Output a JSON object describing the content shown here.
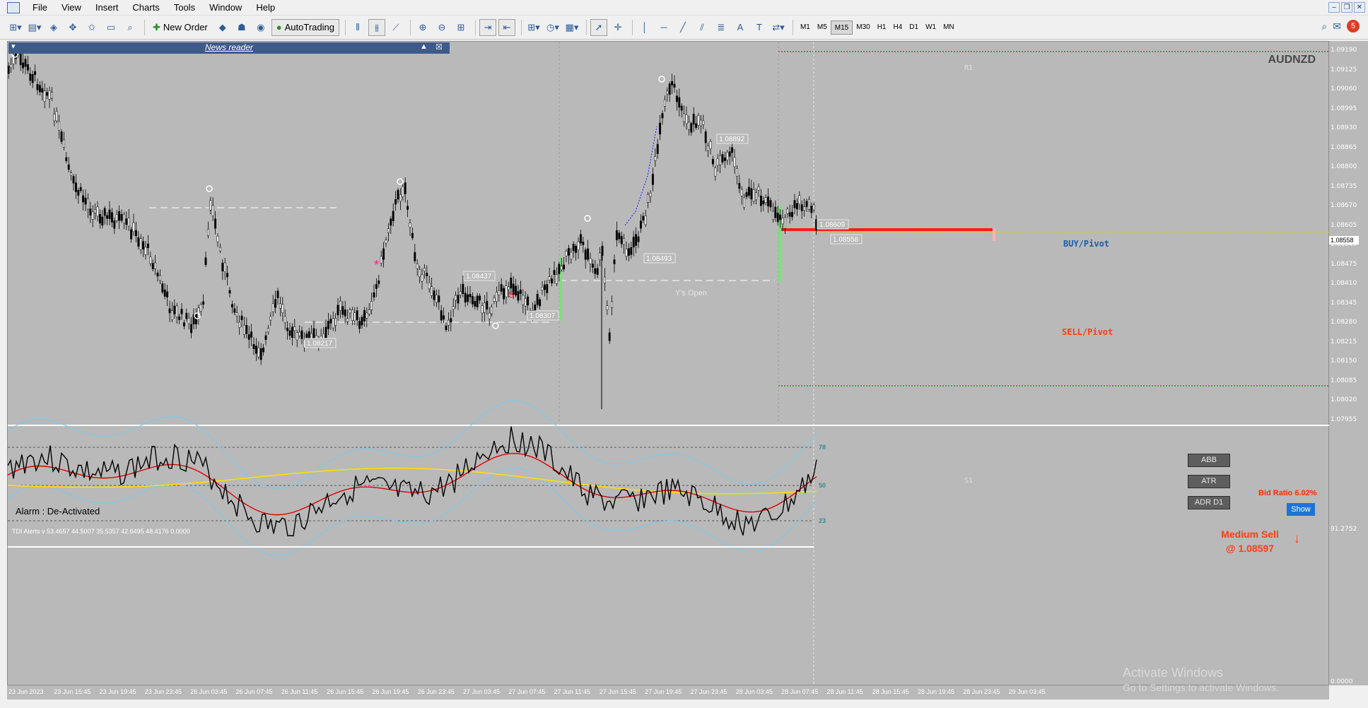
{
  "menu": {
    "items": [
      "File",
      "View",
      "Insert",
      "Charts",
      "Tools",
      "Window",
      "Help"
    ]
  },
  "toolbar": {
    "new_order": "New Order",
    "autotrading": "AutoTrading",
    "timeframes": [
      "M1",
      "M5",
      "M15",
      "M30",
      "H1",
      "H4",
      "D1",
      "W1",
      "MN"
    ],
    "active_timeframe": "M15",
    "notifications": "5"
  },
  "news": {
    "title": "News reader"
  },
  "chart": {
    "symbol": "AUDNZD",
    "alarm": "Alarm : De-Activated",
    "buy_label": "BUY/Pivot",
    "sell_label": "SELL/Pivot",
    "y_open": "Y's Open",
    "r1": "R1",
    "s1": "S1",
    "price_tags": [
      "1.08892",
      "1.08609",
      "1.08558",
      "1.08493",
      "1.08437",
      "1.08307",
      "1.08217"
    ],
    "s_marker": "S",
    "buttons": [
      "ABB",
      "ATR",
      "ADR D1"
    ],
    "bid_ratio": "Bid Ratio 6.02%",
    "show": "Show",
    "signal_line1": "Medium Sell",
    "signal_line2": "@ 1.08597",
    "tdi_title": "TDI Alerts v 53.4657 44.5007 35.5357 42.6495 48.4176 0.0000",
    "tdi_levels": [
      "78",
      "50",
      "23"
    ],
    "colors": {
      "bg": "#b9b9b9",
      "bull_candle": "#ffffff",
      "bear_candle": "#000000",
      "buy": "#1e5ba8",
      "sell": "#ff3b14",
      "tdi_red": "#e00000",
      "tdi_yellow": "#ffe000",
      "tdi_blue": "#7fc8e8",
      "tdi_black": "#000000"
    }
  },
  "price_axis": [
    "1.09190",
    "1.09125",
    "1.09060",
    "1.08995",
    "1.08930",
    "1.08865",
    "1.08800",
    "1.08735",
    "1.08670",
    "1.08605",
    "1.08540",
    "1.08475",
    "1.08410",
    "1.08345",
    "1.08280",
    "1.08215",
    "1.08150",
    "1.08085",
    "1.08020",
    "1.07955"
  ],
  "current_price": "1.08558",
  "tdi_axis": [
    "91.2752",
    "0.0000"
  ],
  "time_axis": [
    "23 Jun 2023",
    "23 Jun 15:45",
    "23 Jun 19:45",
    "23 Jun 23:45",
    "26 Jun 03:45",
    "26 Jun 07:45",
    "26 Jun 11:45",
    "26 Jun 15:45",
    "26 Jun 19:45",
    "26 Jun 23:45",
    "27 Jun 03:45",
    "27 Jun 07:45",
    "27 Jun 11:45",
    "27 Jun 15:45",
    "27 Jun 19:45",
    "27 Jun 23:45",
    "28 Jun 03:45",
    "28 Jun 07:45",
    "28 Jun 11:45",
    "28 Jun 15:45",
    "28 Jun 19:45",
    "28 Jun 23:45",
    "29 Jun 03:45"
  ],
  "watermark": {
    "line1": "Activate Windows",
    "line2": "Go to Settings to activate Windows."
  }
}
